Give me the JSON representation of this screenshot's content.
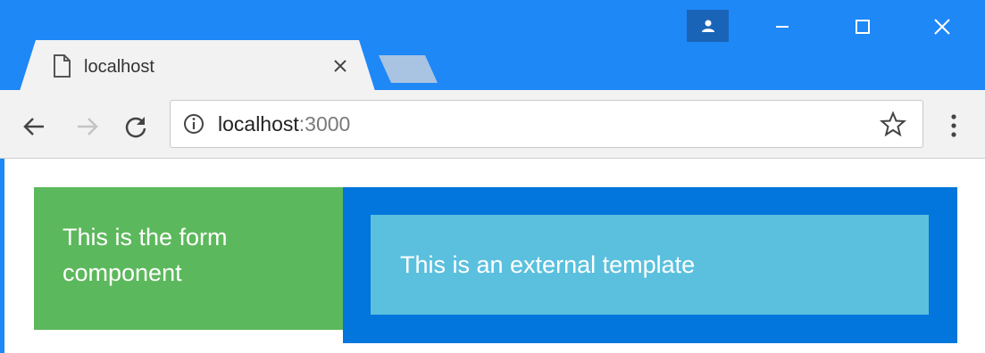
{
  "browser": {
    "tab": {
      "title": "localhost"
    },
    "address": {
      "host": "localhost",
      "port": ":3000"
    }
  },
  "page": {
    "form_component_text": "This is the form component",
    "external_template_text": "This is an external template"
  },
  "colors": {
    "titlebar": "#1e88f6",
    "form_panel": "#5cb85c",
    "outer_panel": "#0276dc",
    "inner_panel": "#5bc0de"
  },
  "icons": [
    "profile-icon",
    "minimize-icon",
    "maximize-icon",
    "close-window-icon",
    "page-icon",
    "close-tab-icon",
    "back-icon",
    "forward-icon",
    "reload-icon",
    "info-icon",
    "star-icon",
    "menu-icon"
  ]
}
